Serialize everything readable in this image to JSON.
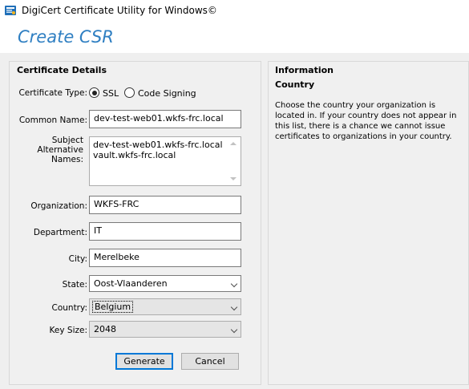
{
  "window": {
    "title": "DigiCert Certificate Utility for Windows©",
    "icon": "digicert-app-icon"
  },
  "header": {
    "title": "Create CSR"
  },
  "details": {
    "title": "Certificate Details",
    "certificate_type": {
      "label": "Certificate Type:",
      "options": [
        "SSL",
        "Code Signing"
      ],
      "selected": "SSL"
    },
    "common_name": {
      "label": "Common Name:",
      "value": "dev-test-web01.wkfs-frc.local"
    },
    "san": {
      "label_lines": [
        "Subject",
        "Alternative",
        "Names:"
      ],
      "lines": [
        "dev-test-web01.wkfs-frc.local",
        "vault.wkfs-frc.local"
      ]
    },
    "organization": {
      "label": "Organization:",
      "value": "WKFS-FRC"
    },
    "department": {
      "label": "Department:",
      "value": "IT"
    },
    "city": {
      "label": "City:",
      "value": "Merelbeke"
    },
    "state": {
      "label": "State:",
      "value": "Oost-Vlaanderen"
    },
    "country": {
      "label": "Country:",
      "value": "Belgium"
    },
    "key_size": {
      "label": "Key Size:",
      "value": "2048"
    },
    "buttons": {
      "generate": "Generate",
      "cancel": "Cancel"
    }
  },
  "info": {
    "title": "Information",
    "subtitle": "Country",
    "text": "Choose the country your organization is located in. If your country does not appear in this list, there is a chance we cannot issue certificates to organizations in your country."
  }
}
